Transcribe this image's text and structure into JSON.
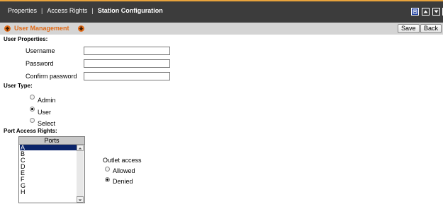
{
  "top_nav": {
    "items": [
      {
        "label": "Properties"
      },
      {
        "label": "Access Rights"
      },
      {
        "label": "Station Configuration"
      }
    ],
    "separator": "|"
  },
  "icons": {
    "top_buttons": [
      "maximize-icon",
      "scroll-up-icon",
      "scroll-down-icon",
      "collapse-icon"
    ],
    "section_arrows": [
      "up-arrow-icon",
      "down-arrow-icon"
    ]
  },
  "subheader": {
    "title": "User Management",
    "save_label": "Save",
    "back_label": "Back"
  },
  "user_properties": {
    "heading": "User Properties:",
    "fields": [
      {
        "label": "Username",
        "value": ""
      },
      {
        "label": "Password",
        "value": ""
      },
      {
        "label": "Confirm password",
        "value": ""
      }
    ]
  },
  "user_type": {
    "heading": "User Type:",
    "options": [
      {
        "label": "Admin",
        "checked": false
      },
      {
        "label": "User",
        "checked": true
      },
      {
        "label": "Select",
        "checked": false
      }
    ]
  },
  "port_access": {
    "heading": "Port Access Rights:",
    "list_header": "Ports",
    "ports": [
      "A",
      "B",
      "C",
      "D",
      "E",
      "F",
      "G",
      "H"
    ],
    "selected_port": "A",
    "outlet_access": {
      "label": "Outlet access",
      "options": [
        {
          "label": "Allowed",
          "checked": false
        },
        {
          "label": "Denied",
          "checked": true
        }
      ]
    }
  },
  "colors": {
    "accent": "#e06a17",
    "topbar": "#3c3c3c",
    "subbar": "#d4d4d4",
    "selection": "#0a246a",
    "icon_blue": "#1f3f9f"
  }
}
